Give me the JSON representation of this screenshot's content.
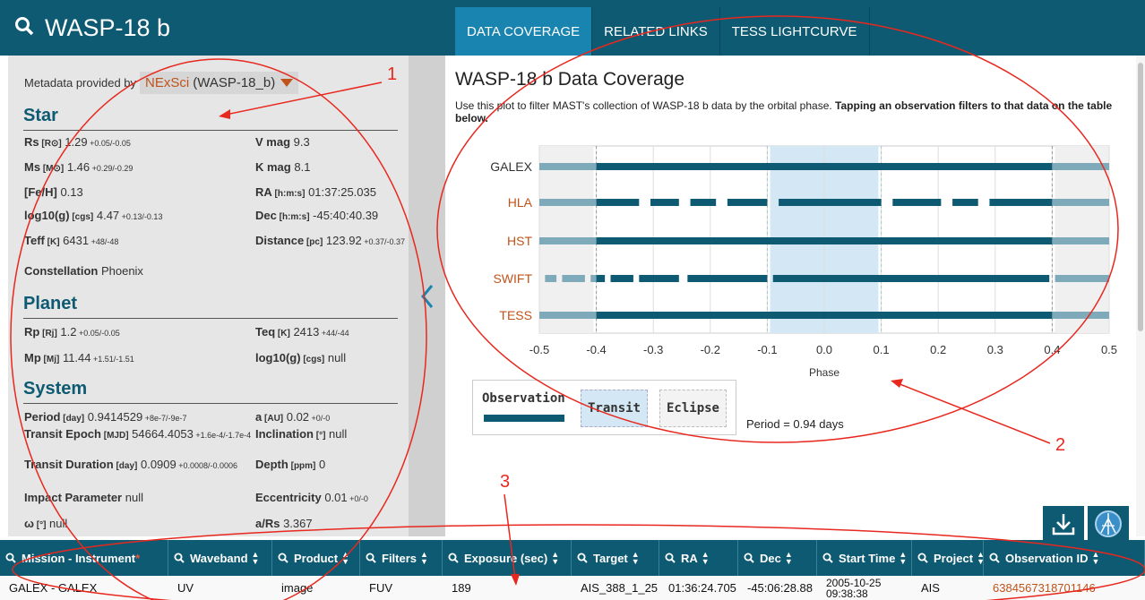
{
  "header": {
    "title": "WASP-18 b",
    "tabs": [
      {
        "label": "DATA COVERAGE",
        "active": true
      },
      {
        "label": "RELATED LINKS",
        "active": false
      },
      {
        "label": "TESS LIGHTCURVE",
        "active": false
      }
    ]
  },
  "metadata": {
    "label": "Metadata provided by",
    "source": "NExSci",
    "object": "(WASP-18_b)"
  },
  "star": {
    "heading": "Star",
    "rows": [
      {
        "name": "Rs",
        "unit": "[R⊙]",
        "value": "1.29",
        "err": "+0.05/-0.05",
        "name2": "V mag",
        "unit2": "",
        "value2": "9.3",
        "err2": ""
      },
      {
        "name": "Ms",
        "unit": "[M⊙]",
        "value": "1.46",
        "err": "+0.29/-0.29",
        "name2": "K mag",
        "unit2": "",
        "value2": "8.1",
        "err2": ""
      },
      {
        "name": "[Fe/H]",
        "unit": "",
        "value": "0.13",
        "err": "",
        "name2": "RA",
        "unit2": "[h:m:s]",
        "value2": "01:37:25.035",
        "err2": ""
      },
      {
        "name": "log10(g)",
        "unit": "[cgs]",
        "value": "4.47",
        "err": "+0.13/-0.13",
        "name2": "Dec",
        "unit2": "[h:m:s]",
        "value2": "-45:40:40.39",
        "err2": ""
      },
      {
        "name": "Teff",
        "unit": "[K]",
        "value": "6431",
        "err": "+48/-48",
        "name2": "Distance",
        "unit2": "[pc]",
        "value2": "123.92",
        "err2": "+0.37/-0.37"
      },
      {
        "name": "Constellation",
        "unit": "",
        "value": "Phoenix",
        "err": "",
        "name2": "",
        "unit2": "",
        "value2": "",
        "err2": ""
      }
    ]
  },
  "planet": {
    "heading": "Planet",
    "rows": [
      {
        "name": "Rp",
        "unit": "[Rj]",
        "value": "1.2",
        "err": "+0.05/-0.05",
        "name2": "Teq",
        "unit2": "[K]",
        "value2": "2413",
        "err2": "+44/-44"
      },
      {
        "name": "Mp",
        "unit": "[Mj]",
        "value": "11.44",
        "err": "+1.51/-1.51",
        "name2": "log10(g)",
        "unit2": "[cgs]",
        "value2": "null",
        "err2": ""
      }
    ]
  },
  "system": {
    "heading": "System",
    "rows": [
      {
        "name": "Period",
        "unit": "[day]",
        "value": "0.9414529",
        "err": "+8e-7/-9e-7",
        "name2": "a",
        "unit2": "[AU]",
        "value2": "0.02",
        "err2": "+0/-0"
      },
      {
        "name": "Transit Epoch",
        "unit": "[MJD]",
        "value": "54664.4053",
        "err": "+1.6e-4/-1.7e-4",
        "name2": "Inclination",
        "unit2": "[°]",
        "value2": "null",
        "err2": ""
      },
      {
        "name": "Transit Duration",
        "unit": "[day]",
        "value": "0.0909",
        "err": "+0.0008/-0.0006",
        "name2": "Depth",
        "unit2": "[ppm]",
        "value2": "0",
        "err2": ""
      },
      {
        "name": "Impact Parameter",
        "unit": "",
        "value": "null",
        "err": "",
        "name2": "Eccentricity",
        "unit2": "",
        "value2": "0.01",
        "err2": "+0/-0"
      },
      {
        "name": "ω",
        "unit": "[°]",
        "value": "null",
        "err": "",
        "name2": "a/Rs",
        "unit2": "",
        "value2": "3.367",
        "err2": ""
      }
    ]
  },
  "coverage": {
    "title": "WASP-18 b Data Coverage",
    "desc_plain": "Use this plot to filter MAST's collection of WASP-18 b data by the orbital phase. ",
    "desc_bold": "Tapping an observation filters to that data on the table below.",
    "period": "Period = 0.94 days"
  },
  "legend": {
    "title": "Observation",
    "transit": "Transit",
    "eclipse": "Eclipse"
  },
  "chart_data": {
    "type": "bar",
    "title": "",
    "xlabel": "Phase",
    "ylabel": "",
    "xlim": [
      -0.5,
      0.5
    ],
    "xticks": [
      "-0.5",
      "-0.4",
      "-0.3",
      "-0.2",
      "-0.1",
      "0.0",
      "0.1",
      "0.2",
      "0.3",
      "0.4",
      "0.5"
    ],
    "transit_window": [
      -0.095,
      0.095
    ],
    "eclipse_windows": [
      [
        -0.5,
        -0.405
      ],
      [
        0.405,
        0.5
      ]
    ],
    "categories": [
      "GALEX",
      "HLA",
      "HST",
      "SWIFT",
      "TESS"
    ],
    "category_colors": [
      "#333333",
      "#c0531a",
      "#c0531a",
      "#c0531a",
      "#c0531a"
    ],
    "series": [
      {
        "name": "GALEX",
        "segments": [
          [
            -0.5,
            0.5
          ]
        ]
      },
      {
        "name": "HLA",
        "segments": [
          [
            -0.5,
            -0.325
          ],
          [
            -0.305,
            -0.255
          ],
          [
            -0.235,
            -0.19
          ],
          [
            -0.17,
            -0.1
          ],
          [
            -0.08,
            0.1
          ],
          [
            0.12,
            0.205
          ],
          [
            0.225,
            0.27
          ],
          [
            0.29,
            0.5
          ]
        ]
      },
      {
        "name": "HST",
        "segments": [
          [
            -0.5,
            0.5
          ]
        ]
      },
      {
        "name": "SWIFT",
        "segments": [
          [
            -0.49,
            -0.47
          ],
          [
            -0.46,
            -0.42
          ],
          [
            -0.41,
            -0.385
          ],
          [
            -0.375,
            -0.335
          ],
          [
            -0.325,
            -0.255
          ],
          [
            -0.24,
            -0.1
          ],
          [
            -0.09,
            0.395
          ],
          [
            0.405,
            0.5
          ]
        ]
      },
      {
        "name": "TESS",
        "segments": [
          [
            -0.5,
            0.5
          ]
        ]
      }
    ]
  },
  "table": {
    "columns": [
      {
        "label": "Mission - Instrument",
        "asterisk": "*"
      },
      {
        "label": "Waveband"
      },
      {
        "label": "Product"
      },
      {
        "label": "Filters"
      },
      {
        "label": "Exposure (sec)"
      },
      {
        "label": "Target"
      },
      {
        "label": "RA"
      },
      {
        "label": "Dec"
      },
      {
        "label": "Start Time"
      },
      {
        "label": "Project"
      },
      {
        "label": "Observation ID"
      }
    ],
    "rows": [
      [
        "GALEX - GALEX",
        "UV",
        "image",
        "FUV",
        "189",
        "AIS_388_1_25",
        "01:36:24.705",
        "-45:06:28.88",
        "2005-10-25 09:38:38",
        "AIS",
        "6384567318701146"
      ]
    ]
  },
  "annotations": [
    "1",
    "2",
    "3"
  ],
  "colors": {
    "header": "#0d5a72",
    "active_tab": "#1a84b0",
    "accent": "#c0531a",
    "bar": "#0d5a72",
    "bar_faded": "#7faab9",
    "transit_band": "#d3e8f4",
    "annotation": "#e8281e"
  }
}
